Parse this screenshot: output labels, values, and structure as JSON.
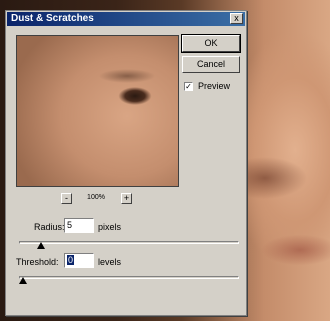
{
  "dialog": {
    "title": "Dust & Scratches",
    "close_symbol": "x"
  },
  "buttons": {
    "ok": "OK",
    "cancel": "Cancel"
  },
  "preview": {
    "checkbox_mark": "✓",
    "checked": true,
    "label": "Preview"
  },
  "zoom": {
    "minus": "-",
    "level": "100%",
    "plus": "+"
  },
  "radius": {
    "label": "Radius:",
    "value": "5",
    "unit": "pixels",
    "slider_fraction": 0.08
  },
  "threshold": {
    "label": "Threshold:",
    "value": "0",
    "unit": "levels",
    "slider_fraction": 0.0
  }
}
